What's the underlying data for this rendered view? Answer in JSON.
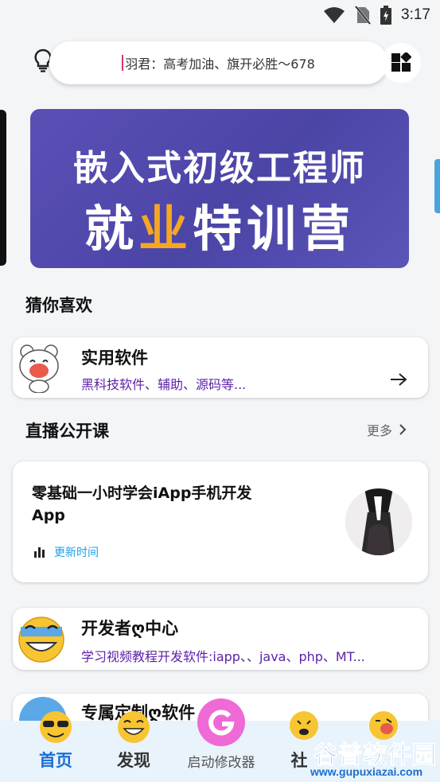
{
  "status_bar": {
    "time": "3:17"
  },
  "header": {
    "marquee": "羽君：高考加油、旗开必胜～678"
  },
  "banner": {
    "line1": "嵌入式初级工程师",
    "line2_a": "就",
    "line2_b": "业",
    "line2_c": "特训营"
  },
  "guess": {
    "title": "猜你喜欢",
    "card": {
      "title": "实用软件",
      "subtitle": "黑科技软件、辅助、源码等..."
    }
  },
  "live": {
    "title": "直播公开课",
    "more": "更多",
    "course": {
      "title": "零基础一小时学会iApp手机开发App",
      "meta": "更新时间"
    }
  },
  "dev": {
    "title": "开发者ღ中心",
    "subtitle": "学习视频教程开发软件:iapp、、java、php、MT..."
  },
  "custom": {
    "title": "专属定制ღ软件"
  },
  "bottom_nav": {
    "items": [
      {
        "label": "首页",
        "active": true
      },
      {
        "label": "发现",
        "active": false
      },
      {
        "label": "启动修改器",
        "active": false
      },
      {
        "label": "社",
        "active": false
      }
    ]
  },
  "watermark": {
    "line1": "谷普软件园",
    "line2": "www.gupuxiazai.com"
  },
  "colors": {
    "accent": "#1a6dd6",
    "purple": "#5b1fa8",
    "banner": "#4b45a6",
    "cyan": "#1da1e8"
  }
}
